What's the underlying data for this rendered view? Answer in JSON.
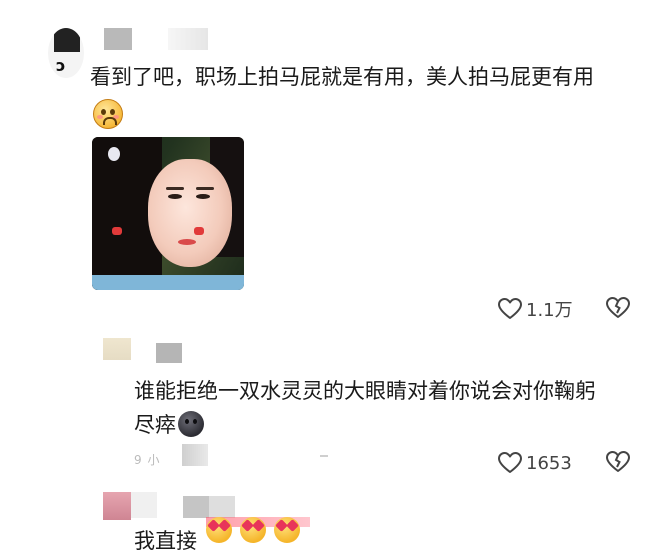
{
  "comment": {
    "text": "看到了吧，职场上拍马屁就是有用，美人拍马屁更有用",
    "avatar_glyph": "ↄ",
    "reaction_icon": "laughing-tear-face-icon",
    "likes": "1.1万"
  },
  "reply1": {
    "text": "谁能拒绝一双水灵灵的大眼睛对着你说会对你鞠躬尽瘁",
    "reaction_icon": "dark-face-emoji-icon",
    "meta_partial": "9 小",
    "likes": "1653"
  },
  "reply2": {
    "text_partial": "我直接",
    "emoji_icons": [
      "heart-eyes-emoji-icon",
      "heart-eyes-emoji-icon",
      "heart-eyes-emoji-icon"
    ]
  },
  "colors": {
    "text": "#1a1a1a",
    "meta": "#bbbbbb",
    "icon": "#444444"
  }
}
